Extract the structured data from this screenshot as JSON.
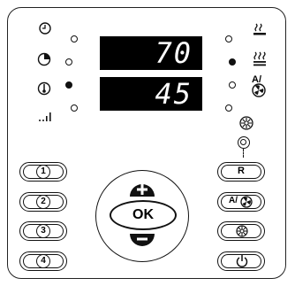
{
  "display": {
    "top_value": "70",
    "bottom_value": "45"
  },
  "left_indicators": [
    {
      "icon": "clock-icon",
      "led_on": false
    },
    {
      "icon": "timer-icon",
      "led_on": false
    },
    {
      "icon": "thermometer-icon",
      "led_on": true
    },
    {
      "icon": "signal-level-icon",
      "led_on": false
    }
  ],
  "right_indicators": [
    {
      "icon": "heat-waves-icon",
      "led_on": false
    },
    {
      "icon": "steam-icon",
      "led_on": true
    },
    {
      "icon": "auto-fan-icon",
      "led_on": false,
      "label": "A/"
    },
    {
      "icon": "defrost-icon",
      "led_on": false
    }
  ],
  "buttons": {
    "program_1": "1",
    "program_2": "2",
    "program_3": "3",
    "program_4": "4",
    "ok": "OK",
    "plus": "+",
    "minus": "−",
    "reset": "R",
    "auto_fan_label": "A/"
  }
}
